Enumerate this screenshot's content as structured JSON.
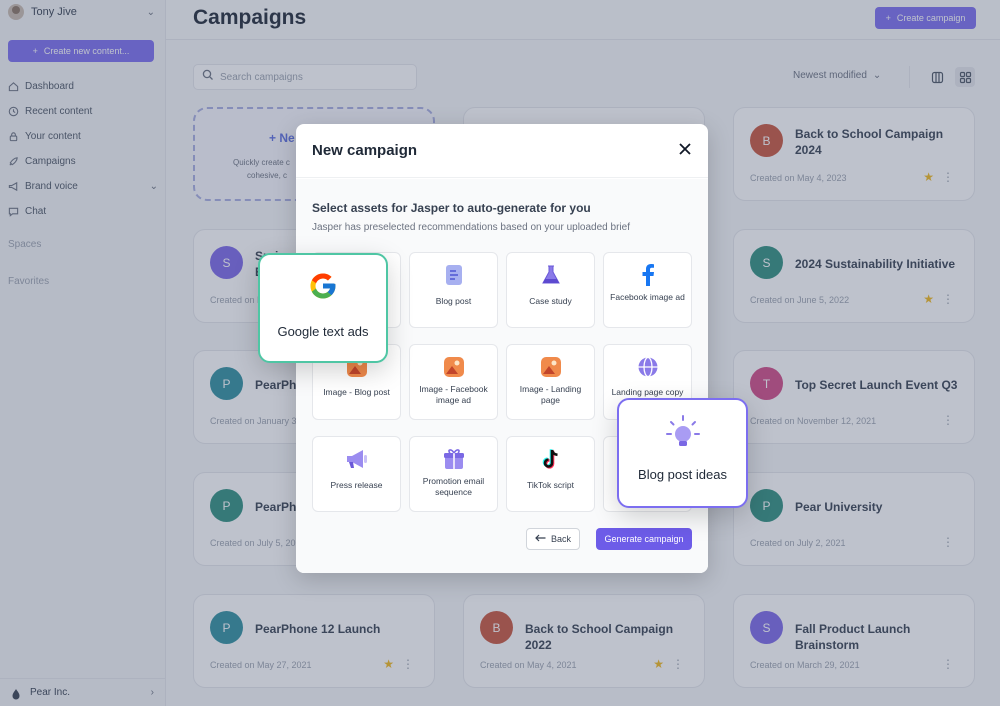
{
  "sidebar": {
    "user_name": "Tony Jive",
    "create_label": "Create new content...",
    "items": [
      {
        "label": "Dashboard",
        "icon": "home-icon"
      },
      {
        "label": "Recent content",
        "icon": "clock-icon"
      },
      {
        "label": "Your content",
        "icon": "lock-icon"
      },
      {
        "label": "Campaigns",
        "icon": "rocket-icon"
      },
      {
        "label": "Brand voice",
        "icon": "megaphone-icon"
      },
      {
        "label": "Chat",
        "icon": "chat-icon"
      }
    ],
    "spaces_label": "Spaces",
    "favorites_label": "Favorites",
    "org_name": "Pear Inc."
  },
  "header": {
    "title": "Campaigns",
    "create_campaign": "Create campaign",
    "search_placeholder": "Search campaigns",
    "sort_label": "Newest modified"
  },
  "new_card": {
    "label": "+ Ne",
    "desc_line1": "Quickly create c",
    "desc_line2": "cohesive, c"
  },
  "cards": [
    {
      "initial": "B",
      "title": "Back to School Campaign 2024",
      "date": "Created on May 4, 2023",
      "color": "#c8553d",
      "star": true
    },
    {
      "initial": "S",
      "title": "Spri",
      "title2": "E",
      "date": "Created on M",
      "color": "#7b68e8",
      "star": false
    },
    {
      "initial": "S",
      "title": "2024 Sustainability Initiative",
      "date": "Created on June 5, 2022",
      "color": "#2f8f7f",
      "star": true
    },
    {
      "initial": "P",
      "title": "PearPho",
      "date": "Created on January 3",
      "color": "#2f8f9f",
      "star": false
    },
    {
      "initial": "T",
      "title": "Top Secret Launch Event Q3",
      "date": "Created on November 12, 2021",
      "color": "#d14b86",
      "star": false
    },
    {
      "initial": "P",
      "title": "PearPho",
      "date": "Created on July 5, 20",
      "color": "#2f8f7f",
      "star": false
    },
    {
      "initial": "P",
      "title": "Pear University",
      "date": "Created on July 2, 2021",
      "color": "#2f8f7f",
      "star": false
    },
    {
      "initial": "P",
      "title": "PearPhone 12 Launch",
      "date": "Created on May 27, 2021",
      "color": "#2f8f9f",
      "star": true
    },
    {
      "initial": "B",
      "title": "Back to School Campaign 2022",
      "date": "Created on May 4, 2021",
      "color": "#c8553d",
      "star": true
    },
    {
      "initial": "S",
      "title": "Fall Product Launch Brainstorm",
      "date": "Created on March 29, 2021",
      "color": "#7b68e8",
      "star": false
    }
  ],
  "modal": {
    "title": "New campaign",
    "heading": "Select assets for Jasper to auto-generate for you",
    "subheading": "Jasper has preselected recommendations based on your uploaded brief",
    "tiles": [
      {
        "label": "Blog post",
        "icon": "document-icon"
      },
      {
        "label": "Case study",
        "icon": "flask-icon"
      },
      {
        "label": "Facebook image ad",
        "icon": "facebook-icon"
      },
      {
        "label": "Image - Blog post",
        "icon": "image-icon"
      },
      {
        "label": "Image - Facebook image ad",
        "icon": "image-icon"
      },
      {
        "label": "Image - Landing page",
        "icon": "image-icon"
      },
      {
        "label": "Landing page copy",
        "icon": "globe-icon"
      },
      {
        "label": "Press release",
        "icon": "megaphone-icon"
      },
      {
        "label": "Promotion email sequence",
        "icon": "gift-icon"
      },
      {
        "label": "TikTok script",
        "icon": "tiktok-icon"
      }
    ],
    "back_label": "Back",
    "generate_label": "Generate campaign"
  },
  "floating": {
    "google_label": "Google text ads",
    "ideas_label": "Blog post ideas"
  },
  "colors": {
    "accent": "#7c6ef0",
    "google_border": "#4fc6a4",
    "star": "#f2b81b"
  }
}
